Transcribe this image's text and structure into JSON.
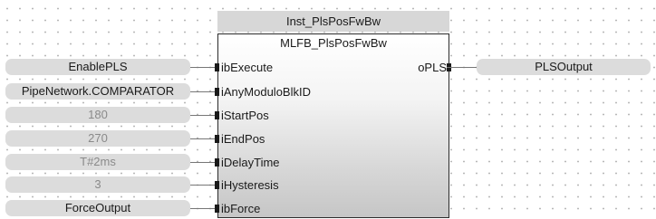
{
  "block": {
    "instance_name": "Inst_PlsPosFwBw",
    "type_name": "MLFB_PlsPosFwBw"
  },
  "inputs": [
    {
      "pin": "ibExecute",
      "value": "EnablePLS"
    },
    {
      "pin": "iAnyModuloBlkID",
      "value": "PipeNetwork.COMPARATOR"
    },
    {
      "pin": "iStartPos",
      "value": "180"
    },
    {
      "pin": "iEndPos",
      "value": "270"
    },
    {
      "pin": "iDelayTime",
      "value": "T#2ms"
    },
    {
      "pin": "iHysteresis",
      "value": "3"
    },
    {
      "pin": "ibForce",
      "value": "ForceOutput"
    }
  ],
  "outputs": [
    {
      "pin": "oPLS",
      "value": "PLSOutput"
    }
  ],
  "colors": {
    "field_background": "#dcdcdc",
    "constant_text": "#8a8a8a",
    "variable_text": "#1a1a1a",
    "block_border": "#2b2b2b"
  }
}
